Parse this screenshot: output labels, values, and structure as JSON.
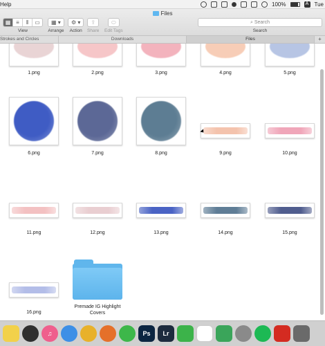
{
  "menubar": {
    "help": "Help",
    "battery": "100%",
    "day": "Tue",
    "input_letter": "A"
  },
  "window": {
    "title": "Files"
  },
  "toolbar": {
    "view_label": "View",
    "arrange_label": "Arrange",
    "action_label": "Action",
    "share_label": "Share",
    "edit_tags_label": "Edit Tags",
    "search_placeholder": "Search",
    "search_label": "Search"
  },
  "tabs": [
    "Strokes and Circles",
    "Downloads",
    "Files",
    "+"
  ],
  "files": [
    {
      "name": "1.png",
      "color": "#e2c6c8"
    },
    {
      "name": "2.png",
      "color": "#f3b3b6"
    },
    {
      "name": "3.png",
      "color": "#ef9aa8"
    },
    {
      "name": "4.png",
      "color": "#f5bd9f"
    },
    {
      "name": "5.png",
      "color": "#9fb2dc"
    },
    {
      "name": "6.png",
      "color": "#3f5cc4"
    },
    {
      "name": "7.png",
      "color": "#5c6896"
    },
    {
      "name": "8.png",
      "color": "#5d7d93"
    },
    {
      "name": "9.png",
      "color": "#f4c3ad"
    },
    {
      "name": "10.png",
      "color": "#f0a6b9"
    },
    {
      "name": "11.png",
      "color": "#f3c1c2"
    },
    {
      "name": "12.png",
      "color": "#e9ced1"
    },
    {
      "name": "13.png",
      "color": "#4a63c4"
    },
    {
      "name": "14.png",
      "color": "#5f7d96"
    },
    {
      "name": "15.png",
      "color": "#505d8e"
    },
    {
      "name": "16.png",
      "color": "#b3bde8"
    }
  ],
  "folder": {
    "name": "Premade IG Highlight Covers"
  },
  "dock": [
    {
      "name": "notes",
      "color": "#f2d14a",
      "glyph": ""
    },
    {
      "name": "quicktime",
      "color": "#2f2f2f",
      "glyph": ""
    },
    {
      "name": "itunes",
      "color": "#ef5f8d",
      "glyph": "♫"
    },
    {
      "name": "safari",
      "color": "#3d8fe6",
      "glyph": ""
    },
    {
      "name": "chrome",
      "color": "#e8b12a",
      "glyph": ""
    },
    {
      "name": "firefox",
      "color": "#e5702a",
      "glyph": ""
    },
    {
      "name": "evernote",
      "color": "#3db74a",
      "glyph": ""
    },
    {
      "name": "photoshop",
      "color": "#0c2541",
      "glyph": "Ps"
    },
    {
      "name": "lightroom",
      "color": "#1d2b3e",
      "glyph": "Lr"
    },
    {
      "name": "facetime",
      "color": "#3cb34a",
      "glyph": ""
    },
    {
      "name": "calendar",
      "color": "#ffffff",
      "glyph": ""
    },
    {
      "name": "numbers",
      "color": "#3aa55a",
      "glyph": ""
    },
    {
      "name": "preferences",
      "color": "#8a8a8a",
      "glyph": ""
    },
    {
      "name": "spotify",
      "color": "#1db954",
      "glyph": ""
    },
    {
      "name": "acrobat",
      "color": "#d42b21",
      "glyph": ""
    },
    {
      "name": "stack",
      "color": "#6a6a6a",
      "glyph": ""
    }
  ]
}
